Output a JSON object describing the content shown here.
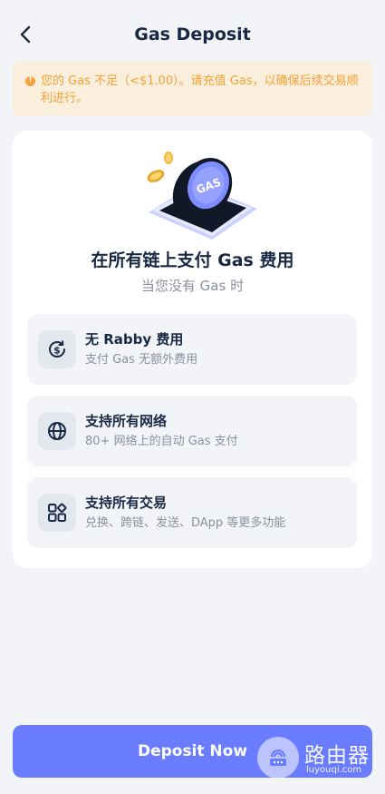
{
  "header": {
    "title": "Gas Deposit"
  },
  "warning": {
    "text": "您的 Gas 不足（<$1.00）。请充值 Gas，以确保后续交易顺利进行。"
  },
  "card": {
    "hero_label": "GAS",
    "title": "在所有链上支付 Gas 费用",
    "subtitle": "当您没有 Gas 时",
    "features": [
      {
        "title": "无 Rabby 费用",
        "desc": "支付 Gas 无额外费用",
        "icon": "dollar-refresh-icon"
      },
      {
        "title": "支持所有网络",
        "desc": "80+ 网络上的自动 Gas 支付",
        "icon": "globe-icon"
      },
      {
        "title": "支持所有交易",
        "desc": "兑换、跨链、发送、DApp 等更多功能",
        "icon": "apps-grid-icon"
      }
    ]
  },
  "deposit_button": {
    "label": "Deposit Now"
  },
  "watermark": {
    "title": "路由器",
    "url": "luyouqi.com"
  },
  "colors": {
    "accent": "#6A7CFF",
    "warning_bg": "#FAEEDC",
    "warning_text": "#F3A235",
    "background": "#F2F4F7"
  }
}
